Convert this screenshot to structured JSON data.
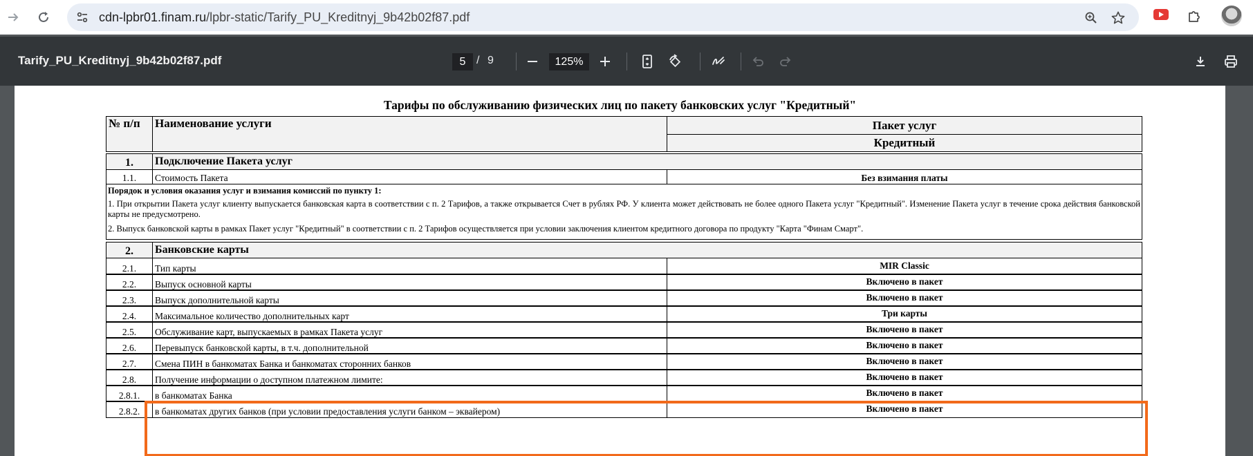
{
  "browser": {
    "url_host": "cdn-lpbr01.finam.ru",
    "url_path": "/lpbr-static/Tarify_PU_Kreditnyj_9b42b02f87.pdf",
    "icons": [
      "arrow-forward-icon",
      "reload-icon",
      "site-info-icon",
      "zoom-icon",
      "star-icon",
      "youtube-extension-icon",
      "puzzle-icon",
      "avatar"
    ]
  },
  "pdf": {
    "title": "Tarify_PU_Kreditnyj_9b42b02f87.pdf",
    "current_page": "5",
    "separator": "/",
    "total_pages": "9",
    "zoom": "125%"
  },
  "doc": {
    "title": "Тарифы по обслуживанию физических лиц по пакету банковских услуг  \"Кредитный\"",
    "header": {
      "num": "№ п/п",
      "name": "Наименование услуги",
      "package": "Пакет услуг",
      "package_name": "Кредитный"
    },
    "section1": {
      "num": "1.",
      "title": "Подключение Пакета услуг",
      "rows": [
        {
          "num": "1.1.",
          "name": "Стоимость Пакета",
          "value": "Без взимания платы"
        }
      ],
      "notes_title": "Порядок и условия оказания услуг и взимания комиссий по пункту 1:",
      "note1": "1. При открытии Пакета услуг клиенту выпускается банковская карта в соответствии с п. 2 Тарифов, а также открывается Счет в рублях РФ. У клиента может действовать не более одного Пакета услуг \"Кредитный\". Изменение Пакета услуг в течение срока действия банковской карты не предусмотрено.",
      "note2": "2. Выпуск банковской карты в рамках Пакет услуг \"Кредитный\"  в соответствии с п. 2 Тарифов осуществляется при условии заключения клиентом кредитного договора по продукту \"Карта \"Финам Смарт\"."
    },
    "section2": {
      "num": "2.",
      "title": "Банковские карты",
      "rows": [
        {
          "num": "2.1.",
          "name": "Тип карты",
          "value": "MIR Classic"
        },
        {
          "num": "2.2.",
          "name": "Выпуск основной карты",
          "value": "Включено в пакет"
        },
        {
          "num": "2.3.",
          "name": "Выпуск дополнительной карты",
          "value": "Включено в пакет"
        },
        {
          "num": "2.4.",
          "name": "Максимальное количество дополнительных карт",
          "value": "Три карты"
        },
        {
          "num": "2.5.",
          "name": "Обслуживание карт, выпускаемых в рамках Пакета услуг",
          "value": "Включено в пакет"
        },
        {
          "num": "2.6.",
          "name": "Перевыпуск банковской карты, в т.ч. дополнительной",
          "value": "Включено в пакет"
        },
        {
          "num": "2.7.",
          "name": "Смена ПИН в банкоматах Банка и банкоматах сторонних банков",
          "value": "Включено в пакет"
        },
        {
          "num": "2.8.",
          "name": "Получение информации о доступном платежном лимите:",
          "value": "Включено в пакет"
        },
        {
          "num": "2.8.1.",
          "name": "в банкоматах Банка",
          "value": "Включено в пакет"
        },
        {
          "num": "2.8.2.",
          "name": "в банкоматах других банков (при условии предоставления услуги банком – эквайером)",
          "value": "Включено в пакет"
        }
      ]
    }
  },
  "colors": {
    "highlight": "#f26a1b",
    "toolbar": "#323639",
    "viewer_bg": "#525659"
  }
}
